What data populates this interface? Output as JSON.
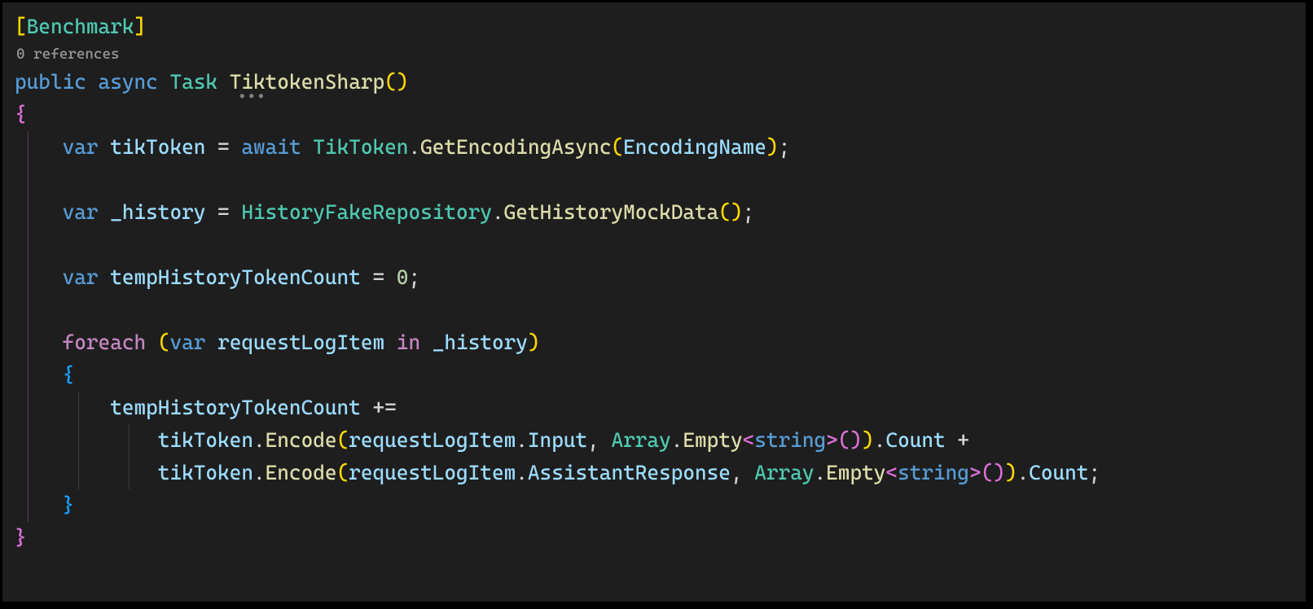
{
  "codelens": {
    "references": "0 references"
  },
  "tokens": {
    "attr_open": "[",
    "attr_name": "Benchmark",
    "attr_close": "]",
    "kw_public": "public",
    "kw_async": "async",
    "type_task": "Task",
    "method_name": "TiktokenSharp",
    "paren_open_y": "(",
    "paren_close_y": ")",
    "brace_open_p": "{",
    "brace_close_p": "}",
    "brace_open_b": "{",
    "brace_close_b": "}",
    "kw_var": "var",
    "id_tikToken": "tikToken",
    "op_assign": "=",
    "kw_await": "await",
    "type_TikToken": "TikToken",
    "dot": ".",
    "fn_GetEncodingAsync": "GetEncodingAsync",
    "id_EncodingName": "EncodingName",
    "semi": ";",
    "id_history": "_history",
    "type_HistoryFakeRepository": "HistoryFakeRepository",
    "fn_GetHistoryMockData": "GetHistoryMockData",
    "id_tempHistoryTokenCount": "tempHistoryTokenCount",
    "num_zero": "0",
    "kw_foreach": "foreach",
    "id_requestLogItem": "requestLogItem",
    "kw_in": "in",
    "op_plus_assign": "+=",
    "fn_Encode": "Encode",
    "prop_Input": "Input",
    "comma": ",",
    "type_Array": "Array",
    "fn_Empty": "Empty",
    "lt": "<",
    "kw_string": "string",
    "gt": ">",
    "prop_Count": "Count",
    "op_plus": "+",
    "prop_AssistantResponse": "AssistantResponse",
    "paren_open_p": "(",
    "paren_close_p": ")",
    "paren_open_b": "(",
    "paren_close_b": ")"
  },
  "hint_dots": "•••"
}
